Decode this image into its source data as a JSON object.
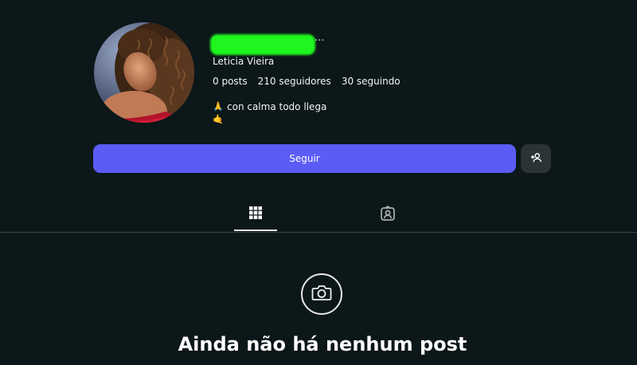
{
  "profile": {
    "full_name": "Leticia Vieira",
    "more_label": "...",
    "stats": {
      "posts": "0 posts",
      "followers": "210 seguidores",
      "following": "30 seguindo"
    },
    "bio": {
      "line1": "con calma todo llega",
      "line1_emoji": "🙏",
      "line2_emoji": "🤙"
    }
  },
  "actions": {
    "follow_label": "Seguir"
  },
  "tabs": {
    "active": "posts-grid",
    "icons": [
      "grid-icon",
      "tagged-person-icon"
    ]
  },
  "empty_state": {
    "title": "Ainda não há nenhum post",
    "icon": "camera-icon"
  },
  "colors": {
    "background": "#0c1719",
    "accent": "#5a5cf5",
    "secondary_button": "#2b3335",
    "redaction": "#1ff51f"
  }
}
